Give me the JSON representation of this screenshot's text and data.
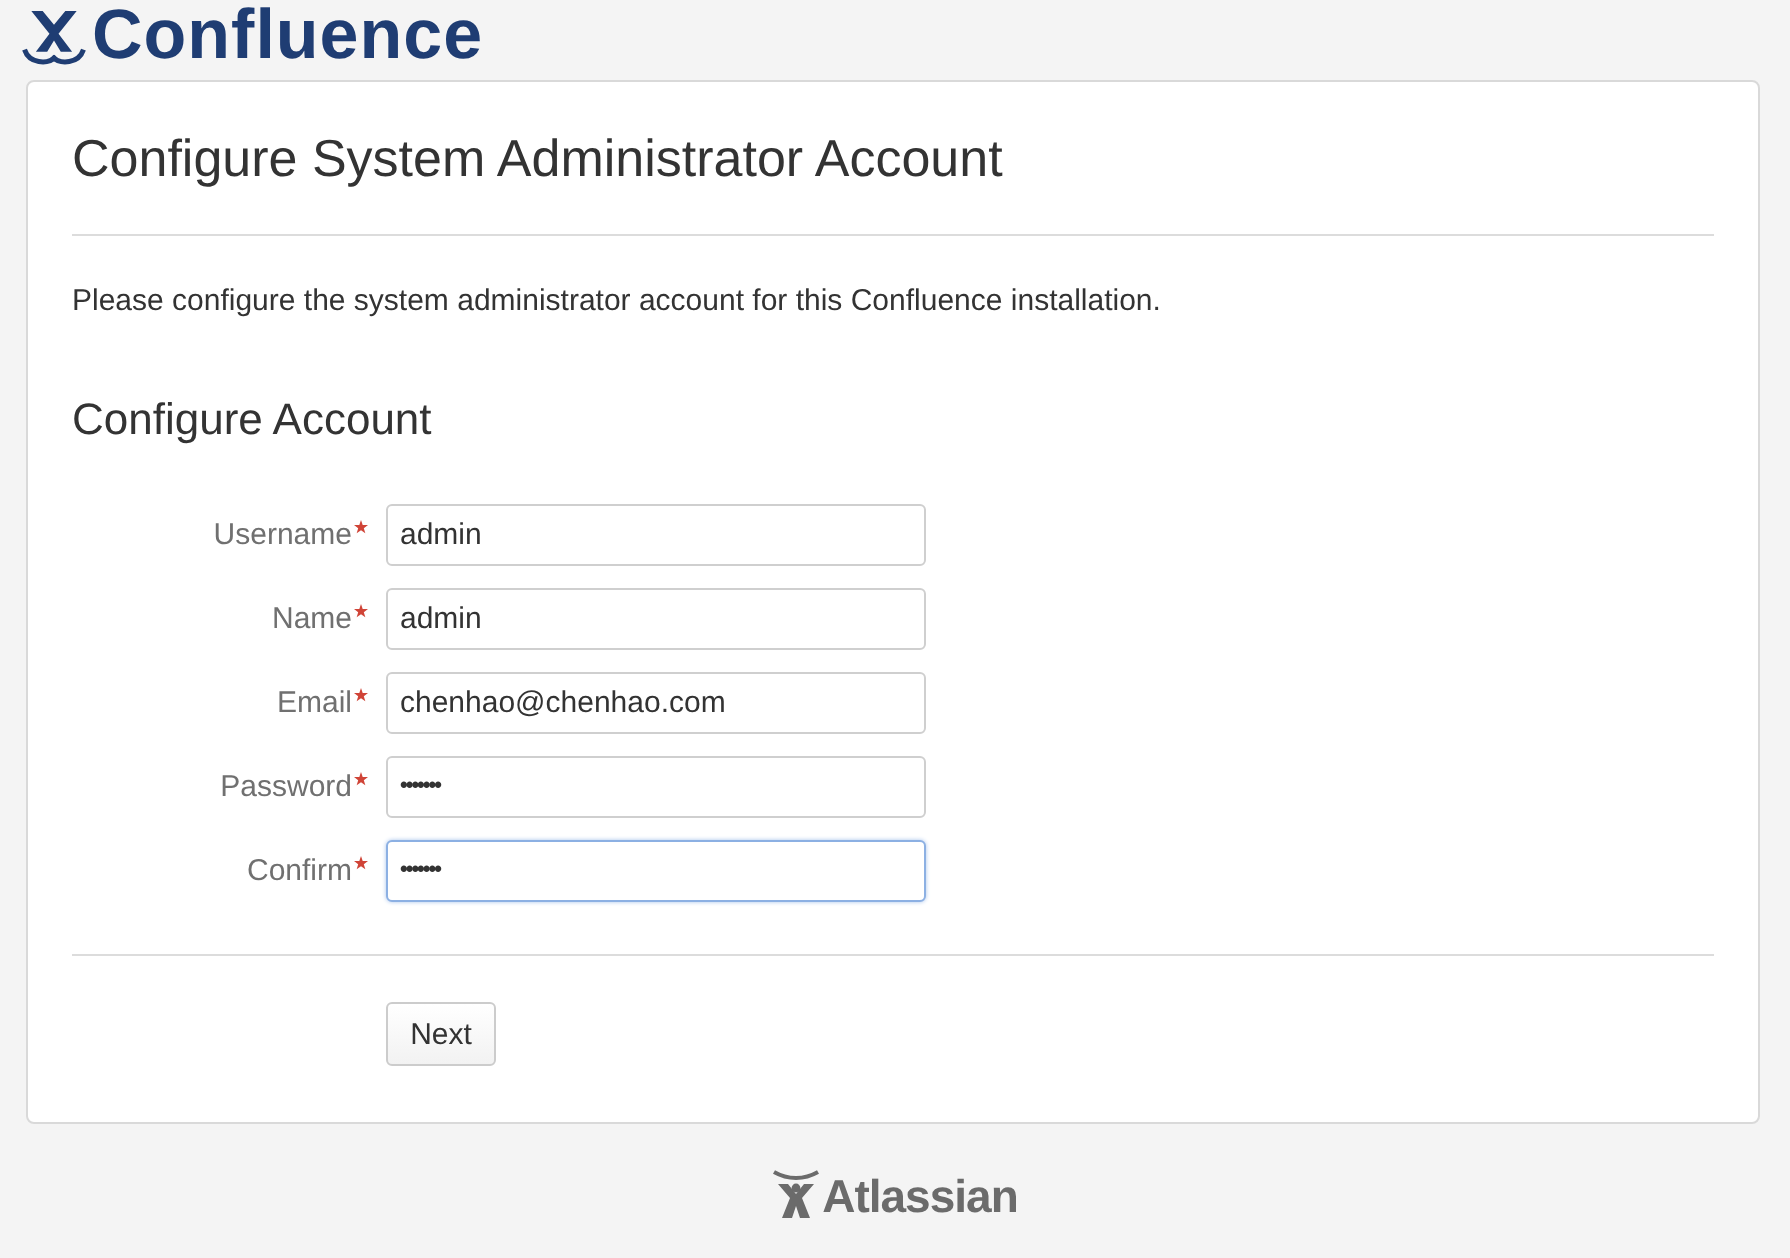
{
  "header": {
    "logo_text": "Confluence"
  },
  "panel": {
    "title": "Configure System Administrator Account",
    "description": "Please configure the system administrator account for this Confluence installation.",
    "section_title": "Configure Account",
    "fields": [
      {
        "label": "Username",
        "required": true,
        "kind": "text",
        "value": "admin",
        "focused": false
      },
      {
        "label": "Name",
        "required": true,
        "kind": "text",
        "value": "admin",
        "focused": false
      },
      {
        "label": "Email",
        "required": true,
        "kind": "text",
        "value": "chenhao@chenhao.com",
        "focused": false
      },
      {
        "label": "Password",
        "required": true,
        "kind": "password",
        "value": "•••••••",
        "focused": false
      },
      {
        "label": "Confirm",
        "required": true,
        "kind": "password",
        "value": "•••••••",
        "focused": true
      }
    ],
    "buttons": [
      {
        "label": "Next"
      }
    ]
  },
  "footer": {
    "logo_text": "Atlassian"
  }
}
